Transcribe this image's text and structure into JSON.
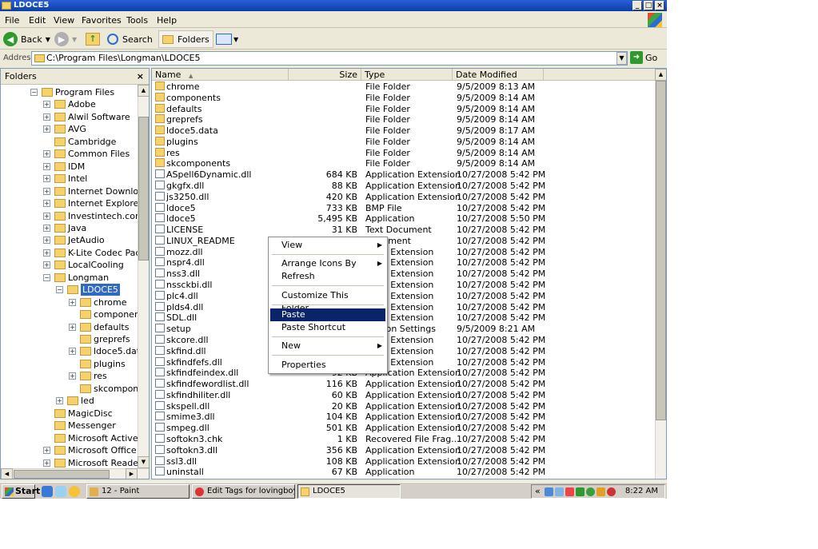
{
  "window": {
    "title": "LDOCE5"
  },
  "menu": [
    "File",
    "Edit",
    "View",
    "Favorites",
    "Tools",
    "Help"
  ],
  "toolbar": {
    "back": "Back",
    "search": "Search",
    "folders": "Folders"
  },
  "address": {
    "label": "Address",
    "path": "C:\\Program Files\\Longman\\LDOCE5",
    "go": "Go"
  },
  "folders_pane": {
    "title": "Folders",
    "close": "×",
    "items": [
      {
        "label": "Program Files",
        "expander": "−",
        "indent": 0
      },
      {
        "label": "Adobe",
        "expander": "+",
        "indent": 1
      },
      {
        "label": "Alwil Software",
        "expander": "+",
        "indent": 1
      },
      {
        "label": "AVG",
        "expander": "+",
        "indent": 1
      },
      {
        "label": "Cambridge",
        "expander": "",
        "indent": 1
      },
      {
        "label": "Common Files",
        "expander": "+",
        "indent": 1
      },
      {
        "label": "IDM",
        "expander": "+",
        "indent": 1
      },
      {
        "label": "Intel",
        "expander": "+",
        "indent": 1
      },
      {
        "label": "Internet Download",
        "expander": "+",
        "indent": 1
      },
      {
        "label": "Internet Explorer",
        "expander": "+",
        "indent": 1
      },
      {
        "label": "Investintech.com Ir",
        "expander": "+",
        "indent": 1
      },
      {
        "label": "Java",
        "expander": "+",
        "indent": 1
      },
      {
        "label": "JetAudio",
        "expander": "+",
        "indent": 1
      },
      {
        "label": "K-Lite Codec Pack",
        "expander": "+",
        "indent": 1
      },
      {
        "label": "LocalCooling",
        "expander": "+",
        "indent": 1
      },
      {
        "label": "Longman",
        "expander": "−",
        "indent": 1
      },
      {
        "label": "LDOCE5",
        "expander": "−",
        "indent": 2,
        "selected": true
      },
      {
        "label": "chrome",
        "expander": "+",
        "indent": 3
      },
      {
        "label": "components",
        "expander": "",
        "indent": 3
      },
      {
        "label": "defaults",
        "expander": "+",
        "indent": 3
      },
      {
        "label": "greprefs",
        "expander": "",
        "indent": 3
      },
      {
        "label": "ldoce5.data",
        "expander": "+",
        "indent": 3
      },
      {
        "label": "plugins",
        "expander": "",
        "indent": 3
      },
      {
        "label": "res",
        "expander": "+",
        "indent": 3
      },
      {
        "label": "skcomponen",
        "expander": "",
        "indent": 3
      },
      {
        "label": "led",
        "expander": "+",
        "indent": 2
      },
      {
        "label": "MagicDisc",
        "expander": "",
        "indent": 1
      },
      {
        "label": "Messenger",
        "expander": "",
        "indent": 1
      },
      {
        "label": "Microsoft ActiveSyr",
        "expander": "",
        "indent": 1
      },
      {
        "label": "Microsoft Office",
        "expander": "+",
        "indent": 1
      },
      {
        "label": "Microsoft Reader",
        "expander": "+",
        "indent": 1
      }
    ]
  },
  "columns": {
    "name": "Name",
    "sort": "▲",
    "size": "Size",
    "type": "Type",
    "date": "Date Modified"
  },
  "files": [
    {
      "name": "chrome",
      "size": "",
      "type": "File Folder",
      "date": "9/5/2009 8:13 AM",
      "kind": "folder"
    },
    {
      "name": "components",
      "size": "",
      "type": "File Folder",
      "date": "9/5/2009 8:14 AM",
      "kind": "folder"
    },
    {
      "name": "defaults",
      "size": "",
      "type": "File Folder",
      "date": "9/5/2009 8:14 AM",
      "kind": "folder"
    },
    {
      "name": "greprefs",
      "size": "",
      "type": "File Folder",
      "date": "9/5/2009 8:14 AM",
      "kind": "folder"
    },
    {
      "name": "ldoce5.data",
      "size": "",
      "type": "File Folder",
      "date": "9/5/2009 8:17 AM",
      "kind": "folder"
    },
    {
      "name": "plugins",
      "size": "",
      "type": "File Folder",
      "date": "9/5/2009 8:14 AM",
      "kind": "folder"
    },
    {
      "name": "res",
      "size": "",
      "type": "File Folder",
      "date": "9/5/2009 8:14 AM",
      "kind": "folder"
    },
    {
      "name": "skcomponents",
      "size": "",
      "type": "File Folder",
      "date": "9/5/2009 8:14 AM",
      "kind": "folder"
    },
    {
      "name": "ASpell6Dynamic.dll",
      "size": "684 KB",
      "type": "Application Extension",
      "date": "10/27/2008 5:42 PM",
      "kind": "file"
    },
    {
      "name": "gkgfx.dll",
      "size": "88 KB",
      "type": "Application Extension",
      "date": "10/27/2008 5:42 PM",
      "kind": "file"
    },
    {
      "name": "js3250.dll",
      "size": "420 KB",
      "type": "Application Extension",
      "date": "10/27/2008 5:42 PM",
      "kind": "file"
    },
    {
      "name": "ldoce5",
      "size": "733 KB",
      "type": "BMP File",
      "date": "10/27/2008 5:42 PM",
      "kind": "file"
    },
    {
      "name": "ldoce5",
      "size": "5,495 KB",
      "type": "Application",
      "date": "10/27/2008 5:50 PM",
      "kind": "file"
    },
    {
      "name": "LICENSE",
      "size": "31 KB",
      "type": "Text Document",
      "date": "10/27/2008 5:42 PM",
      "kind": "file"
    },
    {
      "name": "LINUX_README",
      "size": "",
      "type": "Document",
      "date": "10/27/2008 5:42 PM",
      "kind": "file"
    },
    {
      "name": "mozz.dll",
      "size": "",
      "type": "ation Extension",
      "date": "10/27/2008 5:42 PM",
      "kind": "file"
    },
    {
      "name": "nspr4.dll",
      "size": "",
      "type": "ation Extension",
      "date": "10/27/2008 5:42 PM",
      "kind": "file"
    },
    {
      "name": "nss3.dll",
      "size": "",
      "type": "ation Extension",
      "date": "10/27/2008 5:42 PM",
      "kind": "file"
    },
    {
      "name": "nssckbi.dll",
      "size": "",
      "type": "ation Extension",
      "date": "10/27/2008 5:42 PM",
      "kind": "file"
    },
    {
      "name": "plc4.dll",
      "size": "",
      "type": "ation Extension",
      "date": "10/27/2008 5:42 PM",
      "kind": "file"
    },
    {
      "name": "plds4.dll",
      "size": "",
      "type": "ation Extension",
      "date": "10/27/2008 5:42 PM",
      "kind": "file"
    },
    {
      "name": "SDL.dll",
      "size": "",
      "type": "ation Extension",
      "date": "10/27/2008 5:42 PM",
      "kind": "file"
    },
    {
      "name": "setup",
      "size": "",
      "type": "uration Settings",
      "date": "9/5/2009 8:21 AM",
      "kind": "file"
    },
    {
      "name": "skcore.dll",
      "size": "",
      "type": "ation Extension",
      "date": "10/27/2008 5:42 PM",
      "kind": "file"
    },
    {
      "name": "skfind.dll",
      "size": "",
      "type": "ation Extension",
      "date": "10/27/2008 5:42 PM",
      "kind": "file"
    },
    {
      "name": "skfindfefs.dll",
      "size": "",
      "type": "ation Extension",
      "date": "10/27/2008 5:42 PM",
      "kind": "file"
    },
    {
      "name": "skfindfeindex.dll",
      "size": "92 KB",
      "type": "Application Extension",
      "date": "10/27/2008 5:42 PM",
      "kind": "file"
    },
    {
      "name": "skfindfewordlist.dll",
      "size": "116 KB",
      "type": "Application Extension",
      "date": "10/27/2008 5:42 PM",
      "kind": "file"
    },
    {
      "name": "skfindhiliter.dll",
      "size": "60 KB",
      "type": "Application Extension",
      "date": "10/27/2008 5:42 PM",
      "kind": "file"
    },
    {
      "name": "skspell.dll",
      "size": "20 KB",
      "type": "Application Extension",
      "date": "10/27/2008 5:42 PM",
      "kind": "file"
    },
    {
      "name": "smime3.dll",
      "size": "104 KB",
      "type": "Application Extension",
      "date": "10/27/2008 5:42 PM",
      "kind": "file"
    },
    {
      "name": "smpeg.dll",
      "size": "501 KB",
      "type": "Application Extension",
      "date": "10/27/2008 5:42 PM",
      "kind": "file"
    },
    {
      "name": "softokn3.chk",
      "size": "1 KB",
      "type": "Recovered File Frag...",
      "date": "10/27/2008 5:42 PM",
      "kind": "file"
    },
    {
      "name": "softokn3.dll",
      "size": "356 KB",
      "type": "Application Extension",
      "date": "10/27/2008 5:42 PM",
      "kind": "file"
    },
    {
      "name": "ssl3.dll",
      "size": "108 KB",
      "type": "Application Extension",
      "date": "10/27/2008 5:42 PM",
      "kind": "file"
    },
    {
      "name": "uninstall",
      "size": "67 KB",
      "type": "Application",
      "date": "10/27/2008 5:42 PM",
      "kind": "file"
    }
  ],
  "context_menu": {
    "items": [
      {
        "label": "View",
        "submenu": true
      },
      {
        "label": "Arrange Icons By",
        "submenu": true
      },
      {
        "label": "Refresh",
        "submenu": false
      },
      {
        "label": "Customize This Folder...",
        "submenu": false
      },
      {
        "label": "Paste",
        "submenu": false,
        "highlighted": true
      },
      {
        "label": "Paste Shortcut",
        "submenu": false
      },
      {
        "label": "New",
        "submenu": true
      },
      {
        "label": "Properties",
        "submenu": false
      }
    ]
  },
  "taskbar": {
    "start": "Start",
    "tasks": [
      {
        "label": "12 - Paint",
        "active": false
      },
      {
        "label": "Edit Tags for lovingboyck...",
        "active": false
      },
      {
        "label": "LDOCE5",
        "active": true
      }
    ],
    "clock": "8:22 AM",
    "tray_expand": "«"
  },
  "colors": {
    "title_bar": "#0a3ea8",
    "selection": "#316ac5",
    "menu_highlight": "#0a246a"
  }
}
